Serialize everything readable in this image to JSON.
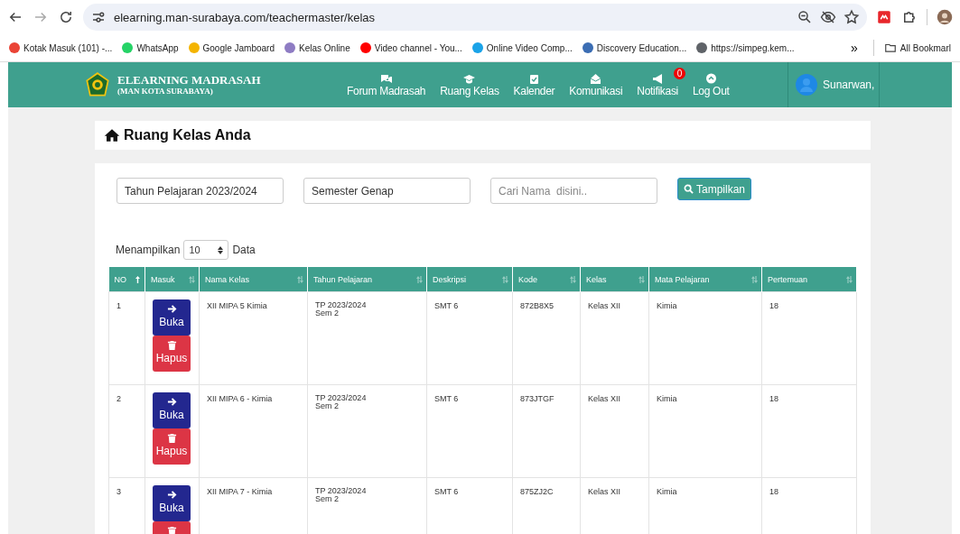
{
  "browser": {
    "url": "elearning.man-surabaya.com/teachermaster/kelas",
    "bookmarks": [
      {
        "label": "Kotak Masuk (101) -...",
        "color": "#ea4335"
      },
      {
        "label": "WhatsApp",
        "color": "#25d366"
      },
      {
        "label": "Google Jamboard",
        "color": "#f4b400"
      },
      {
        "label": "Kelas Online",
        "color": "#8e7cc3"
      },
      {
        "label": "Video channel - You...",
        "color": "#ff0000"
      },
      {
        "label": "Online Video Comp...",
        "color": "#1aa3e8"
      },
      {
        "label": "Discovery Education...",
        "color": "#3b6db3"
      },
      {
        "label": "https://simpeg.kem...",
        "color": "#5f6368"
      }
    ],
    "overflow": "»",
    "all_bookmarks": "All Bookmarl"
  },
  "navbar": {
    "brand": "ELEARNING MADRASAH",
    "subtitle": "(MAN KOTA SURABAYA)",
    "items": [
      {
        "kind": "forum",
        "label": "Forum Madrasah"
      },
      {
        "kind": "class",
        "label": "Ruang Kelas"
      },
      {
        "kind": "calendar",
        "label": "Kalender"
      },
      {
        "kind": "message",
        "label": "Komunikasi"
      },
      {
        "kind": "notification",
        "label": "Notifikasi",
        "badge": "0"
      },
      {
        "kind": "logout",
        "label": "Log Out"
      }
    ],
    "user": "Sunarwan,"
  },
  "page_title": "Ruang Kelas Anda",
  "filters": {
    "year": "Tahun Pelajaran 2023/2024",
    "semester": "Semester Genap",
    "search_placeholder": "Cari Nama  disini..",
    "button": "Tampilkan"
  },
  "length": {
    "before": "Menampilkan",
    "value": "10",
    "after": "Data"
  },
  "table": {
    "columns": [
      {
        "label": "NO",
        "sorted": true
      },
      {
        "label": "Masuk",
        "sorted": false
      },
      {
        "label": "Nama Kelas",
        "sorted": false
      },
      {
        "label": "Tahun Pelajaran",
        "sorted": false
      },
      {
        "label": "Deskripsi",
        "sorted": false
      },
      {
        "label": "Kode",
        "sorted": false
      },
      {
        "label": "Kelas",
        "sorted": false
      },
      {
        "label": "Mata Pelajaran",
        "sorted": false
      },
      {
        "label": "Pertemuan",
        "sorted": false
      }
    ],
    "rows": [
      {
        "no": "1",
        "actions": [
          {
            "kind": "open",
            "label": "Buka"
          },
          {
            "kind": "delete",
            "label": "Hapus"
          }
        ],
        "nama_kelas": "XII MIPA 5 Kimia",
        "tahun": [
          "TP 2023/2024",
          "Sem 2"
        ],
        "deskripsi": "SMT 6",
        "kode": "872B8X5",
        "kelas": "Kelas XII",
        "mapel": "Kimia",
        "pertemuan": "18"
      },
      {
        "no": "2",
        "actions": [
          {
            "kind": "open",
            "label": "Buka"
          },
          {
            "kind": "delete",
            "label": "Hapus"
          }
        ],
        "nama_kelas": "XII MIPA 6 - Kimia",
        "tahun": [
          "TP 2023/2024",
          "Sem 2"
        ],
        "deskripsi": "SMT 6",
        "kode": "873JTGF",
        "kelas": "Kelas XII",
        "mapel": "Kimia",
        "pertemuan": "18"
      },
      {
        "no": "3",
        "actions": [
          {
            "kind": "open",
            "label": "Buka"
          },
          {
            "kind": "delete"
          }
        ],
        "nama_kelas": "XII MIPA 7 - Kimia",
        "tahun": [
          "TP 2023/2024",
          "Sem 2"
        ],
        "deskripsi": "SMT 6",
        "kode": "875ZJ2C",
        "kelas": "Kelas XII",
        "mapel": "Kimia",
        "pertemuan": "18"
      }
    ]
  }
}
